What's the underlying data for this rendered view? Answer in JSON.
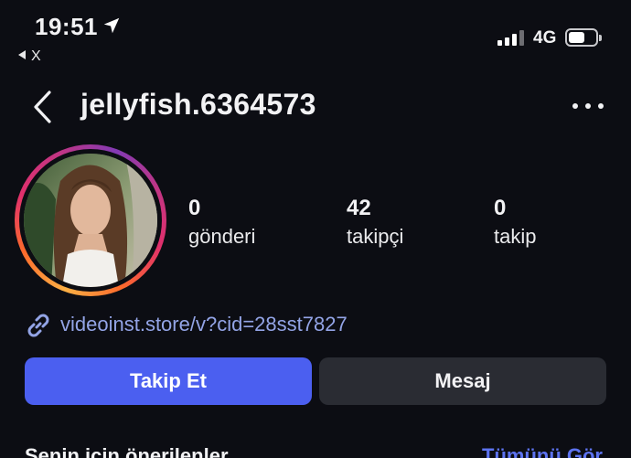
{
  "status_bar": {
    "time": "19:51",
    "back_app_label": "X",
    "network": "4G",
    "battery_level": 0.6
  },
  "header": {
    "username": "jellyfish.6364573",
    "icons": [
      "back-chevron-icon",
      "more-dots-icon"
    ]
  },
  "profile": {
    "stats": [
      {
        "value": "0",
        "label": "gönderi"
      },
      {
        "value": "42",
        "label": "takipçi"
      },
      {
        "value": "0",
        "label": "takip"
      }
    ],
    "link": "videoinst.store/v?cid=28sst7827"
  },
  "actions": {
    "follow_label": "Takip Et",
    "message_label": "Mesaj"
  },
  "suggestions": {
    "title": "Senin için önerilenler",
    "see_all": "Tümünü Gör"
  },
  "colors": {
    "background": "#0c0d13",
    "follow_button": "#4b5ff0",
    "message_button": "#2a2c33",
    "link": "#93a4e6",
    "see_all": "#5d73f0"
  }
}
